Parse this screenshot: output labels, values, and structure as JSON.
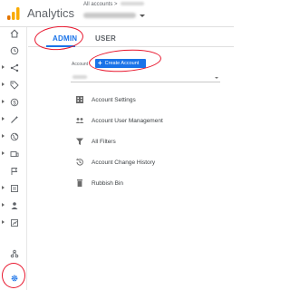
{
  "header": {
    "app_title": "Analytics",
    "accounts_breadcrumb": "All accounts >"
  },
  "tabs": [
    {
      "label": "ADMIN",
      "active": true
    },
    {
      "label": "USER",
      "active": false
    }
  ],
  "account_section": {
    "label": "Account",
    "create_button_label": "Create Account"
  },
  "menu": [
    {
      "label": "Account Settings",
      "icon": "building-icon"
    },
    {
      "label": "Account User Management",
      "icon": "people-icon"
    },
    {
      "label": "All Filters",
      "icon": "filter-icon"
    },
    {
      "label": "Account Change History",
      "icon": "history-icon"
    },
    {
      "label": "Rubbish Bin",
      "icon": "bin-icon"
    }
  ],
  "nav_icons": [
    "home-icon",
    "clock-icon",
    "acquisition-icon",
    "tag-icon",
    "dollar-icon",
    "magic-icon",
    "globe-icon",
    "device-icon",
    "flag-icon",
    "pages-icon",
    "person-icon",
    "explore-icon",
    "share-icon",
    "admin-gear-icon"
  ],
  "colors": {
    "accent_blue": "#1a73e8",
    "annotation_red": "#e8162d",
    "logo_orange": "#f9ab00",
    "logo_dark_orange": "#e37400"
  }
}
